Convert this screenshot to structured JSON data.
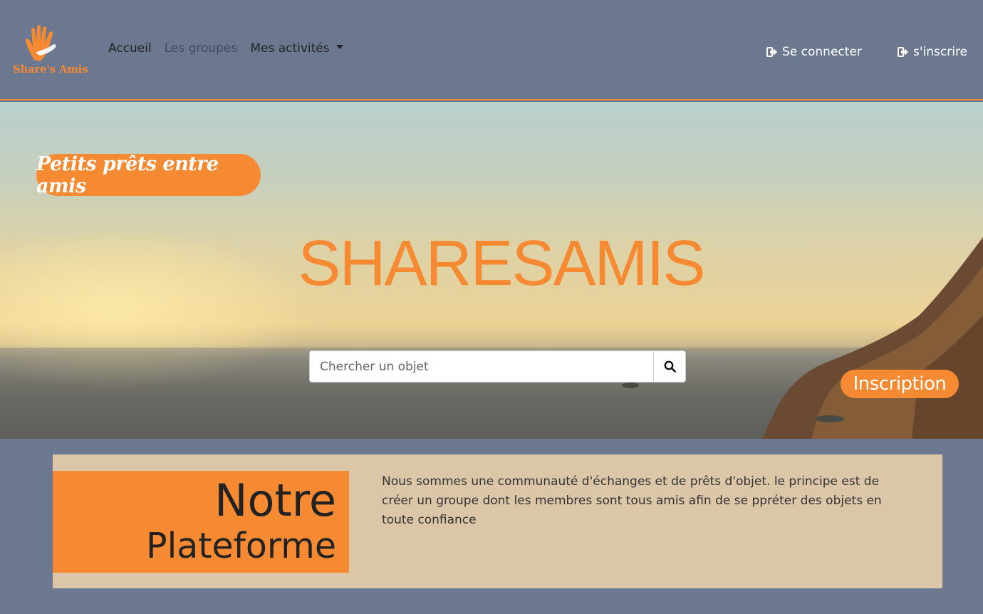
{
  "brand": {
    "logo_text": "Share's Amis",
    "accent": "#f68a33",
    "nav_bg": "#6b7890"
  },
  "nav": {
    "links": [
      "Accueil",
      "Les groupes",
      "Mes activités"
    ],
    "login": "Se connecter",
    "register": "s'inscrire",
    "login_icon": "sign-in-icon",
    "register_icon": "sign-in-icon"
  },
  "hero": {
    "tagline": "Petits prêts entre amis",
    "title": "SHARESAMIS",
    "search_placeholder": "Chercher un objet",
    "search_icon": "search-icon",
    "inscription": "Inscription"
  },
  "platform": {
    "heading_line1": "Notre",
    "heading_line2": "Plateforme",
    "description": "Nous sommes une communauté d'échanges et de prêts d'objet. le principe est de créer un groupe dont les membres sont tous amis afin de se ppréter des objets en toute confiance",
    "bg": "#dcc6a8"
  }
}
